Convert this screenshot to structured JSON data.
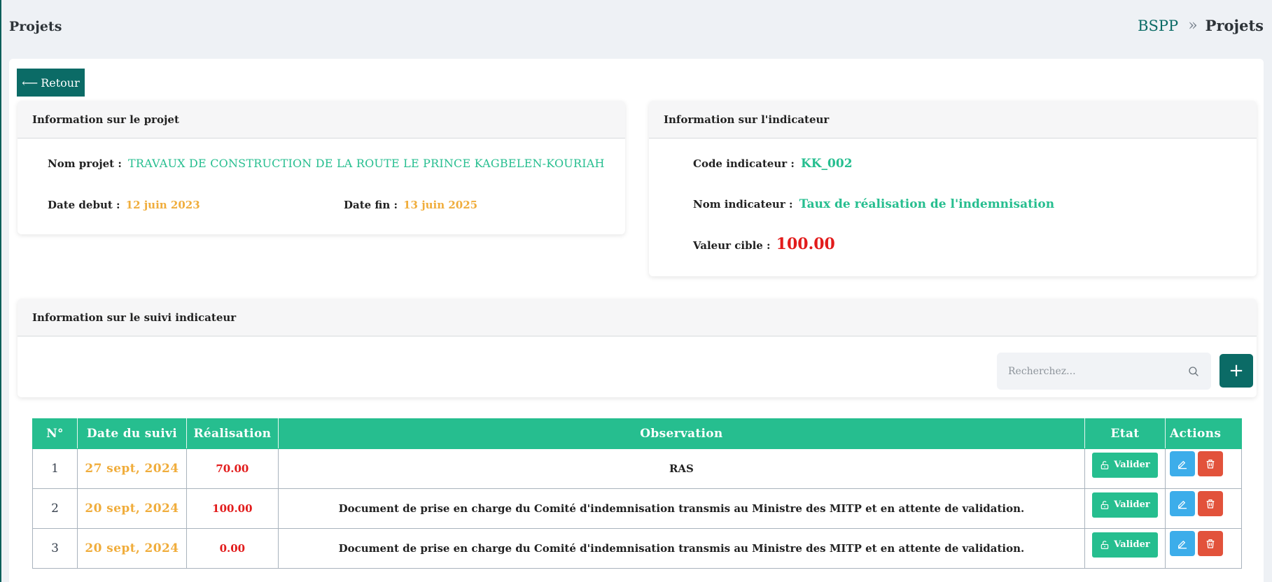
{
  "header": {
    "title": "Projets",
    "breadcrumb": {
      "home": "BSPP",
      "separator": "»",
      "current": "Projets"
    }
  },
  "back_button": {
    "arrow": "⟵",
    "label": "Retour"
  },
  "project_panel": {
    "title": "Information sur le projet",
    "nom_label": "Nom projet :",
    "nom_value": "TRAVAUX DE CONSTRUCTION DE LA ROUTE LE PRINCE KAGBELEN-KOURIAH",
    "date_debut_label": "Date debut :",
    "date_debut_value": "12 juin 2023",
    "date_fin_label": "Date fin :",
    "date_fin_value": "13 juin 2025"
  },
  "indicator_panel": {
    "title": "Information sur l'indicateur",
    "code_label": "Code indicateur :",
    "code_value": "KK_002",
    "nom_label": "Nom indicateur :",
    "nom_value": "Taux de réalisation de l'indemnisation",
    "cible_label": "Valeur cible :",
    "cible_value": "100.00"
  },
  "suivi_panel": {
    "title": "Information sur le suivi indicateur",
    "search_placeholder": "Recherchez...",
    "add_label": "+"
  },
  "table": {
    "headers": [
      "N°",
      "Date du suivi",
      "Réalisation",
      "Observation",
      "Etat",
      "Actions"
    ],
    "rows": [
      {
        "num": "1",
        "date": "27 sept, 2024",
        "realisation": "70.00",
        "observation": "RAS",
        "etat": "Valider"
      },
      {
        "num": "2",
        "date": "20 sept, 2024",
        "realisation": "100.00",
        "observation": "Document de prise en charge du Comité d'indemnisation transmis au Ministre des MITP et en attente de validation.",
        "etat": "Valider"
      },
      {
        "num": "3",
        "date": "20 sept, 2024",
        "realisation": "0.00",
        "observation": "Document de prise en charge du Comité d'indemnisation transmis au Ministre des MITP et en attente de validation.",
        "etat": "Valider"
      }
    ]
  },
  "colors": {
    "primary": "#0b6b66",
    "accent_green": "#26be8f",
    "date_orange": "#f0ad3c",
    "value_red": "#e21b1b",
    "edit_blue": "#3cadea",
    "delete_red": "#e2523b"
  },
  "icons": {
    "search": "search-icon",
    "unlock": "unlock-icon",
    "edit": "edit-icon",
    "delete": "trash-icon"
  }
}
